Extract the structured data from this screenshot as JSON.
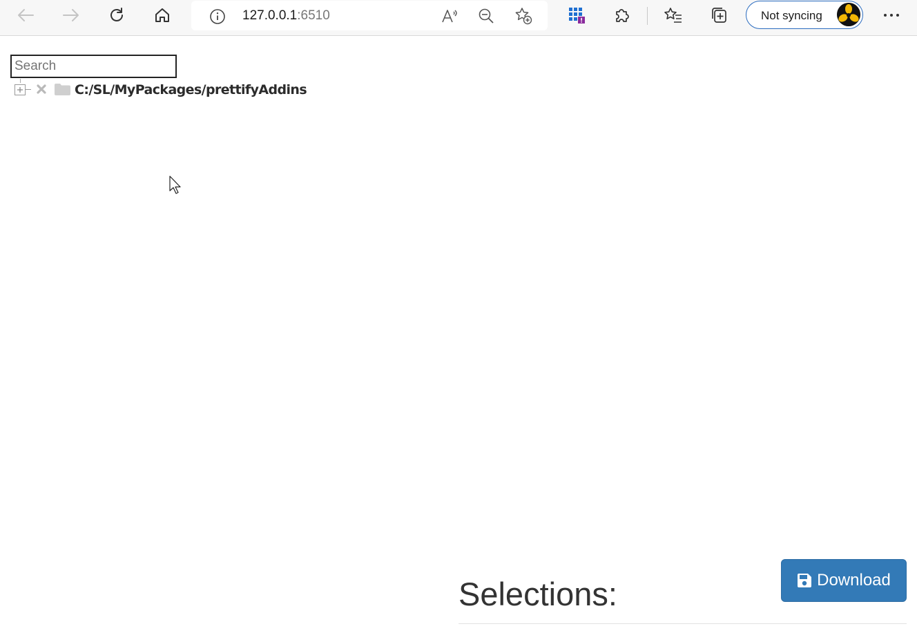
{
  "browser": {
    "address": {
      "host": "127.0.0.1",
      "port": ":6510"
    },
    "profile": {
      "label": "Not syncing"
    },
    "icons": {
      "back": "back-arrow-icon",
      "forward": "forward-arrow-icon",
      "refresh": "refresh-icon",
      "home": "home-icon",
      "info": "info-icon",
      "read_aloud": "read-aloud-icon",
      "zoom_out": "zoom-out-icon",
      "add_favorite": "add-favorite-icon",
      "app_grid": "app-grid-icon",
      "extensions": "puzzle-icon",
      "favorites": "favorites-icon",
      "collections": "collections-icon",
      "more": "more-dots-icon"
    },
    "accent_color": "#2a6bbf"
  },
  "page": {
    "search": {
      "placeholder": "Search",
      "value": ""
    },
    "tree": {
      "nodes": [
        {
          "label": "C:/SL/MyPackages/prettifyAddins",
          "icons": [
            "expand-plus-icon",
            "remove-x-icon",
            "folder-icon"
          ]
        }
      ]
    },
    "selections": {
      "heading": "Selections:"
    },
    "download": {
      "label": "Download",
      "icon": "floppy-save-icon",
      "color": "#337ab7"
    }
  }
}
